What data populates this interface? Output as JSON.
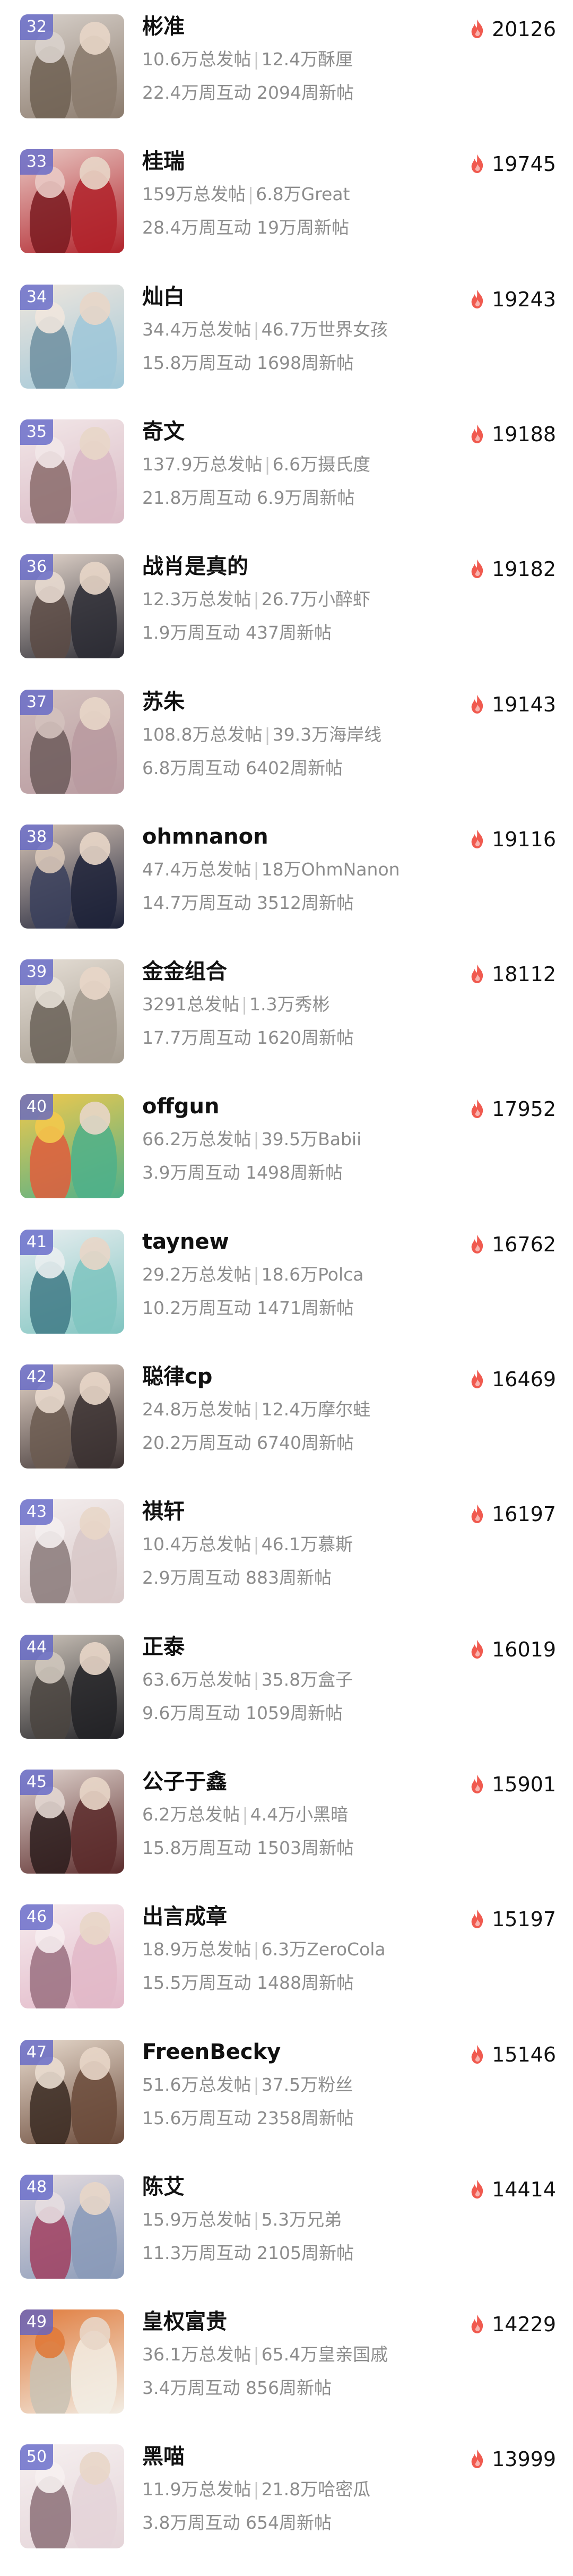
{
  "colors": {
    "rank_badge": "#5f64c8",
    "flame": "#f05a4f",
    "name": "#111111",
    "secondary": "#8d8d8d"
  },
  "separator": "|",
  "items": [
    {
      "rank": "32",
      "name": "彬准",
      "posts": "10.6万总发帖",
      "fans": "12.4万酥厘",
      "weekly_interact": "22.4万周互动",
      "weekly_posts": "2094周新帖",
      "score": "20126",
      "palette": [
        "#8a7a6c",
        "#d9d2cc",
        "#6e6052"
      ]
    },
    {
      "rank": "33",
      "name": "桂瑞",
      "posts": "159万总发帖",
      "fans": "6.8万Great",
      "weekly_interact": "28.4万周互动",
      "weekly_posts": "19万周新帖",
      "score": "19745",
      "palette": [
        "#b0222a",
        "#e9c9c4",
        "#7a1a20"
      ]
    },
    {
      "rank": "34",
      "name": "灿白",
      "posts": "34.4万总发帖",
      "fans": "46.7万世界女孩",
      "weekly_interact": "15.8万周互动",
      "weekly_posts": "1698周新帖",
      "score": "19243",
      "palette": [
        "#9fc7d8",
        "#efe6dd",
        "#6f8fa0"
      ]
    },
    {
      "rank": "35",
      "name": "奇文",
      "posts": "137.9万总发帖",
      "fans": "6.6万摄氏度",
      "weekly_interact": "21.8万周互动",
      "weekly_posts": "6.9万周新帖",
      "score": "19188",
      "palette": [
        "#d9b9c4",
        "#f2e7e8",
        "#8a6b6b"
      ]
    },
    {
      "rank": "36",
      "name": "战肖是真的",
      "posts": "12.3万总发帖",
      "fans": "26.7万小醉虾",
      "weekly_interact": "1.9万周互动",
      "weekly_posts": "437周新帖",
      "score": "19182",
      "palette": [
        "#2c2c34",
        "#e7d9cf",
        "#5a4a44"
      ]
    },
    {
      "rank": "37",
      "name": "苏朱",
      "posts": "108.8万总发帖",
      "fans": "39.3万海岸线",
      "weekly_interact": "6.8万周互动",
      "weekly_posts": "6402周新帖",
      "score": "19143",
      "palette": [
        "#b89aa0",
        "#d3c1bd",
        "#6c5a5a"
      ]
    },
    {
      "rank": "38",
      "name": "ohmnanon",
      "posts": "47.4万总发帖",
      "fans": "18万OhmNanon",
      "weekly_interact": "14.7万周互动",
      "weekly_posts": "3512周新帖",
      "score": "19116",
      "palette": [
        "#1d2238",
        "#d8c6b8",
        "#3a3f5c"
      ]
    },
    {
      "rank": "39",
      "name": "金金组合",
      "posts": "3291总发帖",
      "fans": "1.3万秀彬",
      "weekly_interact": "17.7万周互动",
      "weekly_posts": "1620周新帖",
      "score": "18112",
      "palette": [
        "#a39a8e",
        "#e6dfd6",
        "#6a6158"
      ]
    },
    {
      "rank": "40",
      "name": "offgun",
      "posts": "66.2万总发帖",
      "fans": "39.5万Babii",
      "weekly_interact": "3.9万周互动",
      "weekly_posts": "1498周新帖",
      "score": "17952",
      "palette": [
        "#4fb08a",
        "#f2c94c",
        "#e05d3c"
      ]
    },
    {
      "rank": "41",
      "name": "taynew",
      "posts": "29.2万总发帖",
      "fans": "18.6万Polca",
      "weekly_interact": "10.2万周互动",
      "weekly_posts": "1471周新帖",
      "score": "16762",
      "palette": [
        "#7fc4c0",
        "#e9eef0",
        "#3f7a86"
      ]
    },
    {
      "rank": "42",
      "name": "聪律cp",
      "posts": "24.8万总发帖",
      "fans": "12.4万摩尔蛙",
      "weekly_interact": "20.2万周互动",
      "weekly_posts": "6740周新帖",
      "score": "16469",
      "palette": [
        "#3a3030",
        "#e8d8cc",
        "#6b5a50"
      ]
    },
    {
      "rank": "43",
      "name": "祺轩",
      "posts": "10.4万总发帖",
      "fans": "46.1万慕斯",
      "weekly_interact": "2.9万周互动",
      "weekly_posts": "883周新帖",
      "score": "16197",
      "palette": [
        "#d8c8c8",
        "#f4eeee",
        "#8a7a7a"
      ]
    },
    {
      "rank": "44",
      "name": "正泰",
      "posts": "63.6万总发帖",
      "fans": "35.8万盒子",
      "weekly_interact": "9.6万周互动",
      "weekly_posts": "1059周新帖",
      "score": "16019",
      "palette": [
        "#222226",
        "#cfc6bc",
        "#4a4440"
      ]
    },
    {
      "rank": "45",
      "name": "公子于鑫",
      "posts": "6.2万总发帖",
      "fans": "4.4万小黑暗",
      "weekly_interact": "15.8万周互动",
      "weekly_posts": "1503周新帖",
      "score": "15901",
      "palette": [
        "#5a2a2a",
        "#e2d6d0",
        "#2c1c1c"
      ]
    },
    {
      "rank": "46",
      "name": "出言成章",
      "posts": "18.9万总发帖",
      "fans": "6.3万ZeroCola",
      "weekly_interact": "15.5万周互动",
      "weekly_posts": "1488周新帖",
      "score": "15197",
      "palette": [
        "#e2b8c8",
        "#f6ecee",
        "#9a7080"
      ]
    },
    {
      "rank": "47",
      "name": "FreenBecky",
      "posts": "51.6万总发帖",
      "fans": "37.5万粉丝",
      "weekly_interact": "15.6万周互动",
      "weekly_posts": "2358周新帖",
      "score": "15146",
      "palette": [
        "#6a4a3a",
        "#e9dccf",
        "#3a2a22"
      ]
    },
    {
      "rank": "48",
      "name": "陈艾",
      "posts": "15.9万总发帖",
      "fans": "5.3万兄弟",
      "weekly_interact": "11.3万周互动",
      "weekly_posts": "2105周新帖",
      "score": "14414",
      "palette": [
        "#8a9ab8",
        "#e6dde0",
        "#a04060"
      ]
    },
    {
      "rank": "49",
      "name": "皇权富贵",
      "posts": "36.1万总发帖",
      "fans": "65.4万皇亲国戚",
      "weekly_interact": "3.4万周互动",
      "weekly_posts": "856周新帖",
      "score": "14229",
      "palette": [
        "#f2ede4",
        "#e07a3a",
        "#c9c2b4"
      ]
    },
    {
      "rank": "50",
      "name": "黑喵",
      "posts": "11.9万总发帖",
      "fans": "21.8万哈密瓜",
      "weekly_interact": "3.8万周互动",
      "weekly_posts": "654周新帖",
      "score": "13999",
      "palette": [
        "#e4d4d8",
        "#f6f0f0",
        "#8c7078"
      ]
    }
  ]
}
